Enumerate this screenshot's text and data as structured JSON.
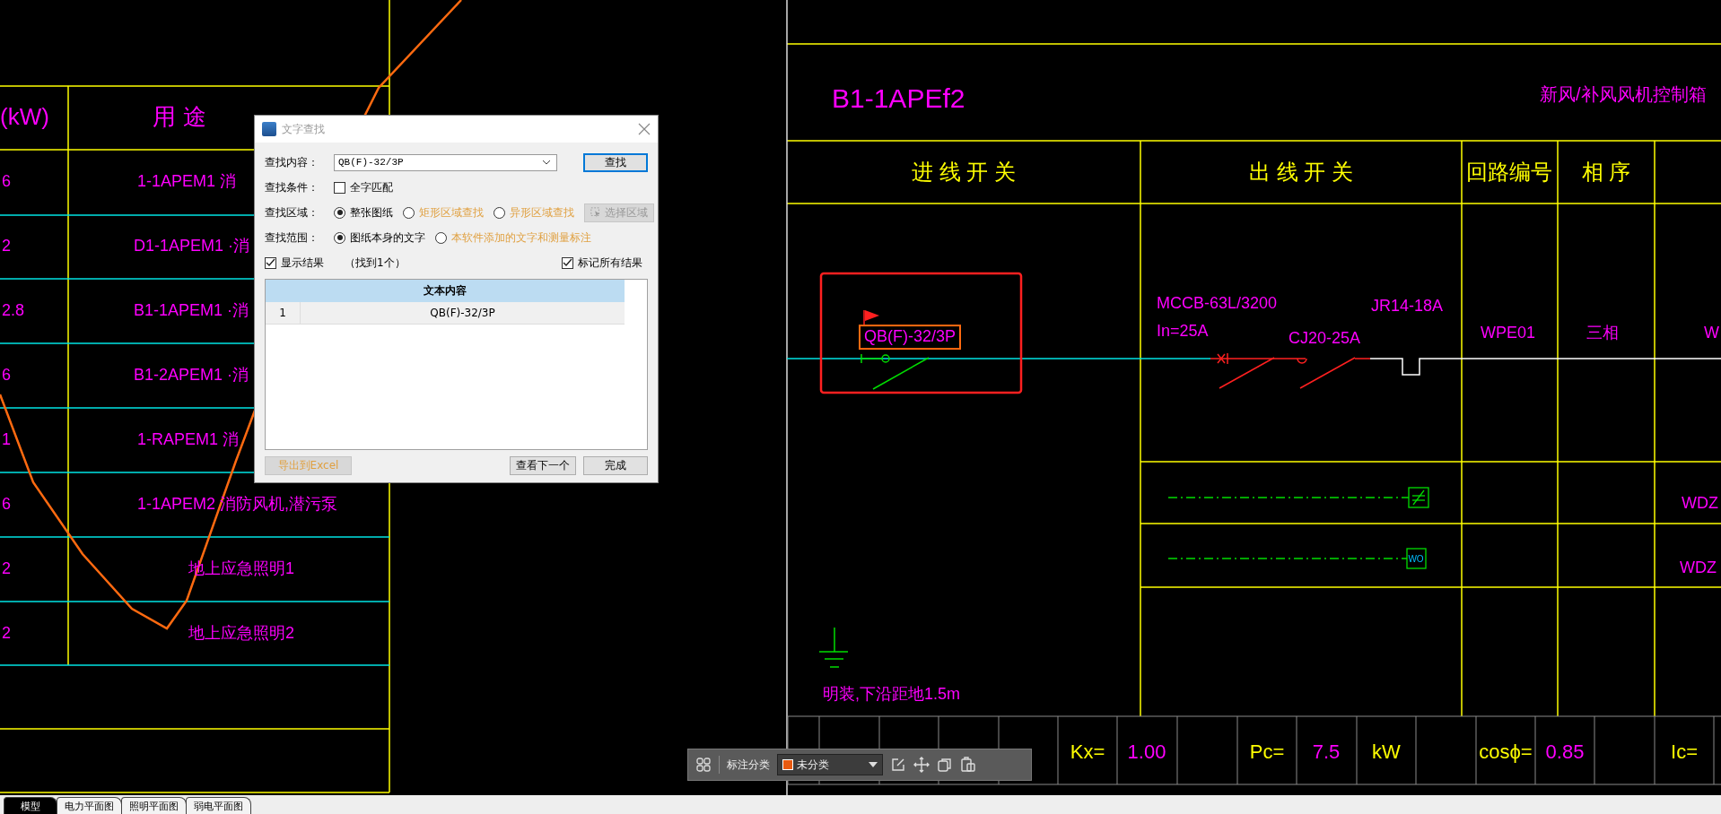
{
  "left_table": {
    "header": {
      "column_1": "(kW)",
      "column_2": "用    途"
    },
    "rows": [
      {
        "column_1": "6",
        "column_2": "1-1APEM1 消"
      },
      {
        "column_1": "2",
        "column_2": "D1-1APEM1 ·消"
      },
      {
        "column_1": "2.8",
        "column_2": "B1-1APEM1 ·消"
      },
      {
        "column_1": "6",
        "column_2": "B1-2APEM1 ·消"
      },
      {
        "column_1": "1",
        "column_2": "1-RAPEM1 消"
      },
      {
        "column_1": "6",
        "column_2": "1-1APEM2 消防风机,潜污泵"
      },
      {
        "column_1": "2",
        "column_2": "地上应急照明1"
      },
      {
        "column_1": "2",
        "column_2": "地上应急照明2"
      }
    ]
  },
  "diagram": {
    "title": "B1-1APEf2",
    "subtitle": "新风/补风风机控制箱",
    "headers": [
      "进 线 开 关",
      "出 线 开 关",
      "回路编号",
      "相 序"
    ],
    "breaker_label": "QB(F)-32/3P",
    "found": true,
    "labels": [
      "MCCB-63L/3200",
      "In=25A",
      "CJ20-25A",
      "JR14-18A",
      "WPE01",
      "三相",
      "W"
    ],
    "symbol_label": "WO",
    "branch_labels": [
      "WDZ",
      "WDZ"
    ],
    "note": "明装,下沿距地1.5m",
    "summary": [
      {
        "text": "Kx=",
        "kind": "label"
      },
      {
        "text": "1.00",
        "kind": "value"
      },
      {
        "text": "Pc=",
        "kind": "label"
      },
      {
        "text": "7.5",
        "kind": "value"
      },
      {
        "text": "kW",
        "kind": "label"
      },
      {
        "text": "cosϕ=",
        "kind": "label"
      },
      {
        "text": "0.85",
        "kind": "value"
      },
      {
        "text": "Ic=",
        "kind": "label"
      }
    ]
  },
  "dialog": {
    "title": "文字查找",
    "search": {
      "label": "查找内容：",
      "value": "QB(F)-32/3P",
      "button": "查找"
    },
    "condition": {
      "label": "查找条件：",
      "option": {
        "label": "全字匹配",
        "checked": false
      }
    },
    "area": {
      "label": "查找区域：",
      "options": [
        {
          "label": "整张图纸",
          "selected": true,
          "accent": false
        },
        {
          "label": "矩形区域查找",
          "selected": false,
          "accent": true
        },
        {
          "label": "异形区域查找",
          "selected": false,
          "accent": true
        }
      ],
      "button": {
        "label": "选择区域",
        "disabled": true
      }
    },
    "scope": {
      "label": "查找范围：",
      "options": [
        {
          "label": "图纸本身的文字",
          "selected": true,
          "accent": false
        },
        {
          "label": "本软件添加的文字和测量标注",
          "selected": false,
          "accent": true
        }
      ]
    },
    "show_results": {
      "label": "显示结果",
      "checked": true
    },
    "found_count": "（找到1个）",
    "mark_all": {
      "label": "标记所有结果",
      "checked": true
    },
    "results": {
      "column": "文本内容",
      "rows": [
        {
          "index": "1",
          "text": "QB(F)-32/3P"
        }
      ]
    },
    "buttons": [
      {
        "label": "导出到Excel",
        "disabled": true,
        "accent": true
      },
      {
        "label": "查看下一个",
        "disabled": false,
        "accent": false
      },
      {
        "label": "完成",
        "disabled": false,
        "accent": false
      }
    ]
  },
  "toolbar": {
    "label": "标注分类",
    "category": "未分类"
  },
  "tabs": [
    {
      "label": "模型",
      "selected": true
    },
    {
      "label": "电力平面图",
      "selected": false
    },
    {
      "label": "照明平面图",
      "selected": false
    },
    {
      "label": "弱电平面图",
      "selected": false
    }
  ]
}
